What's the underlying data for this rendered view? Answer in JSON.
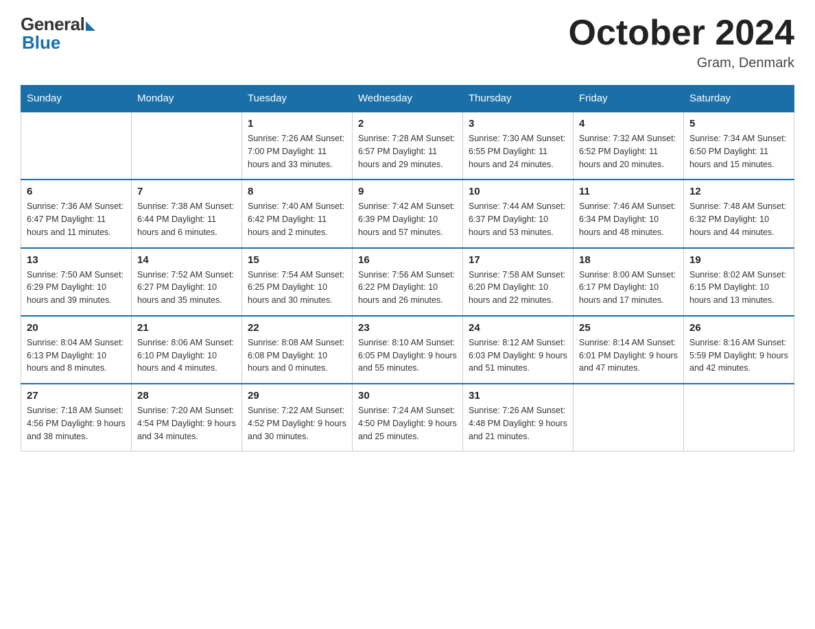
{
  "logo": {
    "general": "General",
    "blue": "Blue"
  },
  "title": {
    "month_year": "October 2024",
    "location": "Gram, Denmark"
  },
  "weekdays": [
    "Sunday",
    "Monday",
    "Tuesday",
    "Wednesday",
    "Thursday",
    "Friday",
    "Saturday"
  ],
  "weeks": [
    [
      {
        "day": "",
        "info": ""
      },
      {
        "day": "",
        "info": ""
      },
      {
        "day": "1",
        "info": "Sunrise: 7:26 AM\nSunset: 7:00 PM\nDaylight: 11 hours\nand 33 minutes."
      },
      {
        "day": "2",
        "info": "Sunrise: 7:28 AM\nSunset: 6:57 PM\nDaylight: 11 hours\nand 29 minutes."
      },
      {
        "day": "3",
        "info": "Sunrise: 7:30 AM\nSunset: 6:55 PM\nDaylight: 11 hours\nand 24 minutes."
      },
      {
        "day": "4",
        "info": "Sunrise: 7:32 AM\nSunset: 6:52 PM\nDaylight: 11 hours\nand 20 minutes."
      },
      {
        "day": "5",
        "info": "Sunrise: 7:34 AM\nSunset: 6:50 PM\nDaylight: 11 hours\nand 15 minutes."
      }
    ],
    [
      {
        "day": "6",
        "info": "Sunrise: 7:36 AM\nSunset: 6:47 PM\nDaylight: 11 hours\nand 11 minutes."
      },
      {
        "day": "7",
        "info": "Sunrise: 7:38 AM\nSunset: 6:44 PM\nDaylight: 11 hours\nand 6 minutes."
      },
      {
        "day": "8",
        "info": "Sunrise: 7:40 AM\nSunset: 6:42 PM\nDaylight: 11 hours\nand 2 minutes."
      },
      {
        "day": "9",
        "info": "Sunrise: 7:42 AM\nSunset: 6:39 PM\nDaylight: 10 hours\nand 57 minutes."
      },
      {
        "day": "10",
        "info": "Sunrise: 7:44 AM\nSunset: 6:37 PM\nDaylight: 10 hours\nand 53 minutes."
      },
      {
        "day": "11",
        "info": "Sunrise: 7:46 AM\nSunset: 6:34 PM\nDaylight: 10 hours\nand 48 minutes."
      },
      {
        "day": "12",
        "info": "Sunrise: 7:48 AM\nSunset: 6:32 PM\nDaylight: 10 hours\nand 44 minutes."
      }
    ],
    [
      {
        "day": "13",
        "info": "Sunrise: 7:50 AM\nSunset: 6:29 PM\nDaylight: 10 hours\nand 39 minutes."
      },
      {
        "day": "14",
        "info": "Sunrise: 7:52 AM\nSunset: 6:27 PM\nDaylight: 10 hours\nand 35 minutes."
      },
      {
        "day": "15",
        "info": "Sunrise: 7:54 AM\nSunset: 6:25 PM\nDaylight: 10 hours\nand 30 minutes."
      },
      {
        "day": "16",
        "info": "Sunrise: 7:56 AM\nSunset: 6:22 PM\nDaylight: 10 hours\nand 26 minutes."
      },
      {
        "day": "17",
        "info": "Sunrise: 7:58 AM\nSunset: 6:20 PM\nDaylight: 10 hours\nand 22 minutes."
      },
      {
        "day": "18",
        "info": "Sunrise: 8:00 AM\nSunset: 6:17 PM\nDaylight: 10 hours\nand 17 minutes."
      },
      {
        "day": "19",
        "info": "Sunrise: 8:02 AM\nSunset: 6:15 PM\nDaylight: 10 hours\nand 13 minutes."
      }
    ],
    [
      {
        "day": "20",
        "info": "Sunrise: 8:04 AM\nSunset: 6:13 PM\nDaylight: 10 hours\nand 8 minutes."
      },
      {
        "day": "21",
        "info": "Sunrise: 8:06 AM\nSunset: 6:10 PM\nDaylight: 10 hours\nand 4 minutes."
      },
      {
        "day": "22",
        "info": "Sunrise: 8:08 AM\nSunset: 6:08 PM\nDaylight: 10 hours\nand 0 minutes."
      },
      {
        "day": "23",
        "info": "Sunrise: 8:10 AM\nSunset: 6:05 PM\nDaylight: 9 hours\nand 55 minutes."
      },
      {
        "day": "24",
        "info": "Sunrise: 8:12 AM\nSunset: 6:03 PM\nDaylight: 9 hours\nand 51 minutes."
      },
      {
        "day": "25",
        "info": "Sunrise: 8:14 AM\nSunset: 6:01 PM\nDaylight: 9 hours\nand 47 minutes."
      },
      {
        "day": "26",
        "info": "Sunrise: 8:16 AM\nSunset: 5:59 PM\nDaylight: 9 hours\nand 42 minutes."
      }
    ],
    [
      {
        "day": "27",
        "info": "Sunrise: 7:18 AM\nSunset: 4:56 PM\nDaylight: 9 hours\nand 38 minutes."
      },
      {
        "day": "28",
        "info": "Sunrise: 7:20 AM\nSunset: 4:54 PM\nDaylight: 9 hours\nand 34 minutes."
      },
      {
        "day": "29",
        "info": "Sunrise: 7:22 AM\nSunset: 4:52 PM\nDaylight: 9 hours\nand 30 minutes."
      },
      {
        "day": "30",
        "info": "Sunrise: 7:24 AM\nSunset: 4:50 PM\nDaylight: 9 hours\nand 25 minutes."
      },
      {
        "day": "31",
        "info": "Sunrise: 7:26 AM\nSunset: 4:48 PM\nDaylight: 9 hours\nand 21 minutes."
      },
      {
        "day": "",
        "info": ""
      },
      {
        "day": "",
        "info": ""
      }
    ]
  ]
}
